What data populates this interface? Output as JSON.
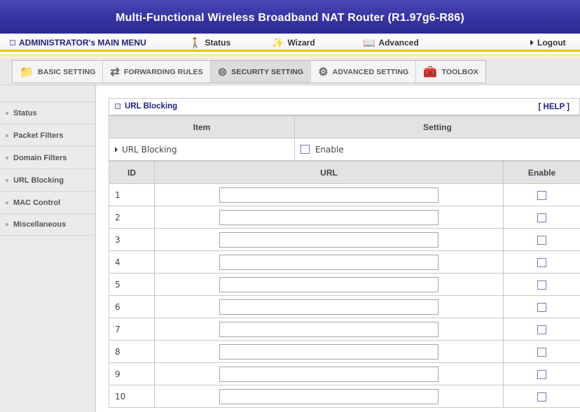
{
  "window": {
    "title": "Multi-Functional Wireless Broadband NAT Router (R1.97g6-R86)"
  },
  "main_menu": {
    "admin": "ADMINISTRATOR's MAIN MENU",
    "status": "Status",
    "wizard": "Wizard",
    "advanced": "Advanced",
    "logout": "Logout"
  },
  "tabs": [
    {
      "label": "BASIC SETTING",
      "icon": "folder-icon"
    },
    {
      "label": "FORWARDING RULES",
      "icon": "arrows-icon"
    },
    {
      "label": "SECURITY SETTING",
      "icon": "lock-icon"
    },
    {
      "label": "ADVANCED SETTING",
      "icon": "gear-icon"
    },
    {
      "label": "TOOLBOX",
      "icon": "toolbox-icon"
    }
  ],
  "sidebar": {
    "items": [
      {
        "label": "Status"
      },
      {
        "label": "Packet Filters"
      },
      {
        "label": "Domain Filters"
      },
      {
        "label": "URL Blocking"
      },
      {
        "label": "MAC Control"
      },
      {
        "label": "Miscellaneous"
      }
    ]
  },
  "panel": {
    "title": "URL Blocking",
    "help": "[ HELP ]",
    "col_item": "Item",
    "col_setting": "Setting",
    "row_label": "URL Blocking",
    "enable_label": "Enable",
    "col_id": "ID",
    "col_url": "URL",
    "col_enable": "Enable",
    "rows": [
      {
        "id": "1"
      },
      {
        "id": "2"
      },
      {
        "id": "3"
      },
      {
        "id": "4"
      },
      {
        "id": "5"
      },
      {
        "id": "6"
      },
      {
        "id": "7"
      },
      {
        "id": "8"
      },
      {
        "id": "9"
      },
      {
        "id": "10"
      }
    ]
  },
  "colors": {
    "banner": "#3a37a6",
    "accent_yellow": "#e8c400",
    "link_blue": "#1f1f7a"
  }
}
